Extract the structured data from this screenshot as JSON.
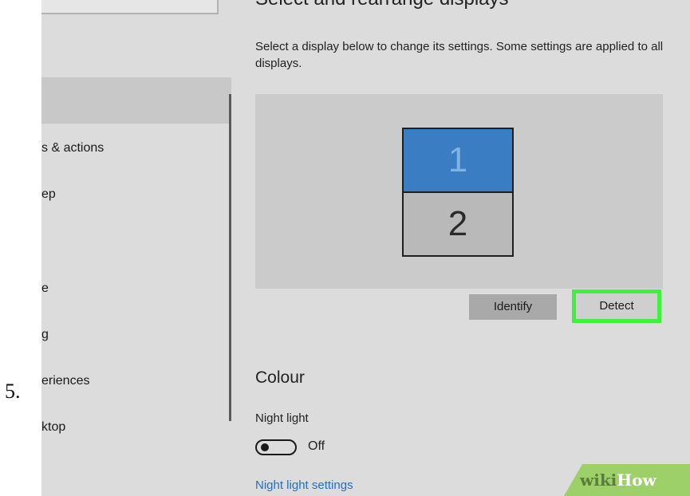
{
  "step": {
    "number": "5."
  },
  "sidebar": {
    "items": [
      {
        "label": "s & actions"
      },
      {
        "label": "ep"
      },
      {
        "label": "e"
      },
      {
        "label": "g"
      },
      {
        "label": "eriences"
      },
      {
        "label": "ktop"
      }
    ]
  },
  "main": {
    "section_title": "Select and rearrange displays",
    "description": "Select a display below to change its settings. Some settings are applied to all displays.",
    "displays": [
      {
        "number": "1",
        "selected": true,
        "color": "#3a7dc2"
      },
      {
        "number": "2",
        "selected": false,
        "color": "#b9b9b9"
      }
    ],
    "buttons": {
      "identify": "Identify",
      "detect": "Detect"
    },
    "highlight_color": "#3ff03f",
    "colour_heading": "Colour",
    "night_light": {
      "label": "Night light",
      "state": "Off",
      "settings_link": "Night light settings"
    }
  },
  "watermark": {
    "part1": "wiki",
    "part2": "How"
  }
}
